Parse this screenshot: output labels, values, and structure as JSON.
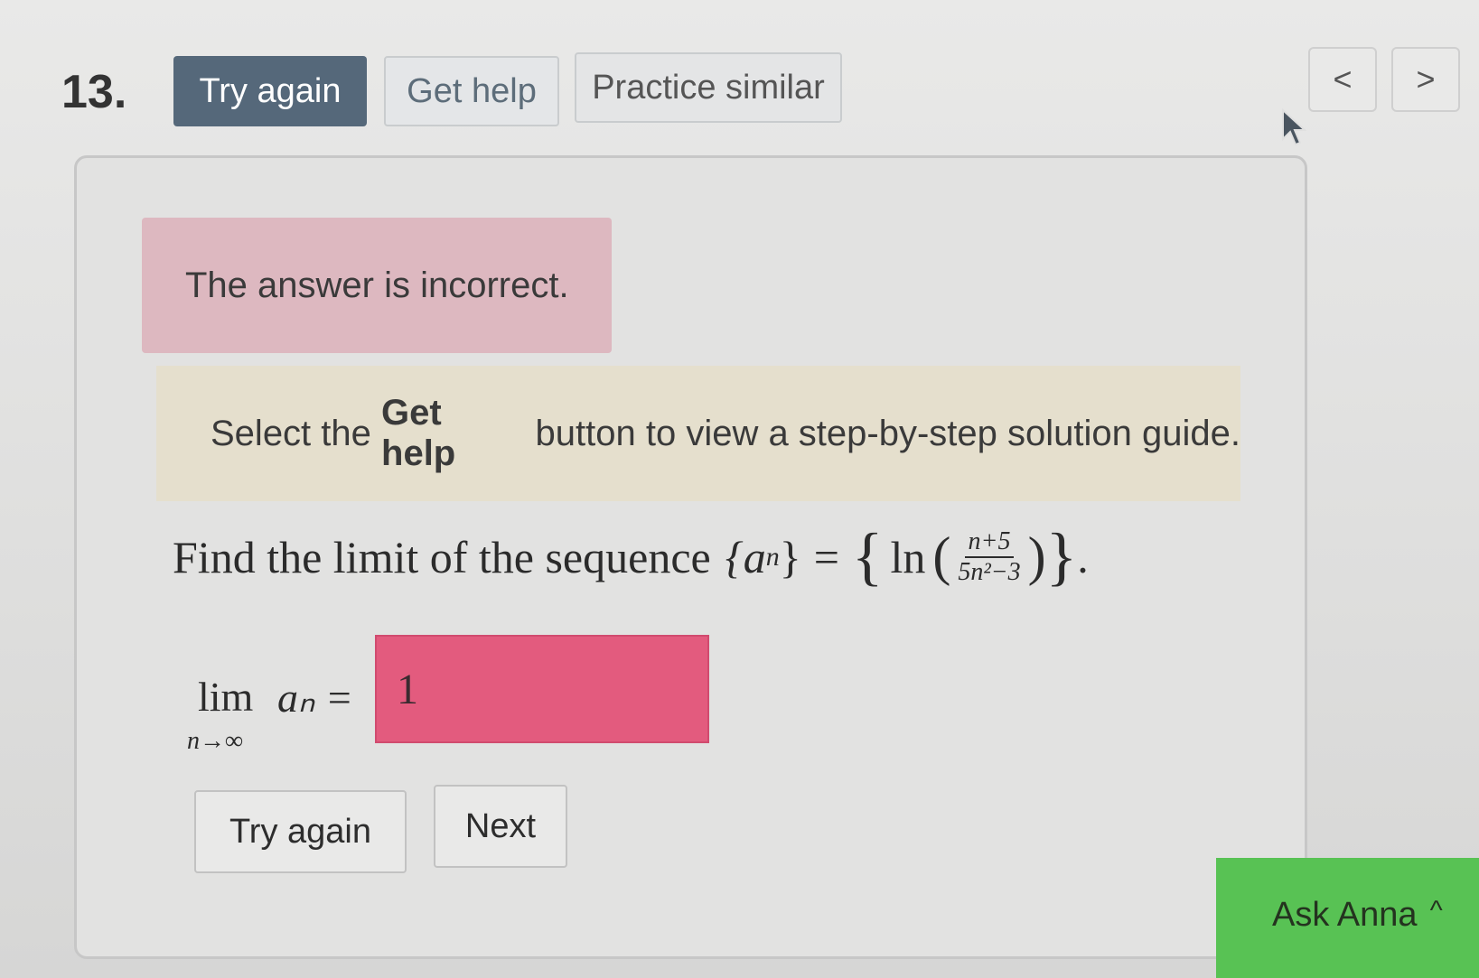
{
  "header": {
    "question_number": "13.",
    "try_again_label": "Try again",
    "get_help_label": "Get help",
    "practice_similar_label": "Practice similar",
    "prev_icon": "<",
    "next_icon": ">"
  },
  "feedback": {
    "incorrect_message": "The answer is incorrect.",
    "hint_prefix": "Select the ",
    "hint_bold": "Get help",
    "hint_suffix": " button to view a step-by-step solution guide."
  },
  "question": {
    "prompt": "Find the limit of the sequence",
    "sequence_name": "{a",
    "sequence_sub": "n",
    "sequence_close": "}",
    "equals": "=",
    "ln": "ln",
    "numerator": "n+5",
    "denominator": "5n²−3",
    "period": "."
  },
  "limit": {
    "lim": "lim",
    "subscript": "n→∞",
    "expression": "aₙ =",
    "answer_value": "1"
  },
  "actions": {
    "try_again_label": "Try again",
    "next_label": "Next"
  },
  "assistant": {
    "label": "Ask Anna",
    "chevron": "^"
  },
  "colors": {
    "primary_button": "#55687a",
    "incorrect_bg": "#ddb8c0",
    "hint_bg": "#e5dfcd",
    "answer_error": "#e35b7e",
    "assistant_green": "#58c254"
  }
}
